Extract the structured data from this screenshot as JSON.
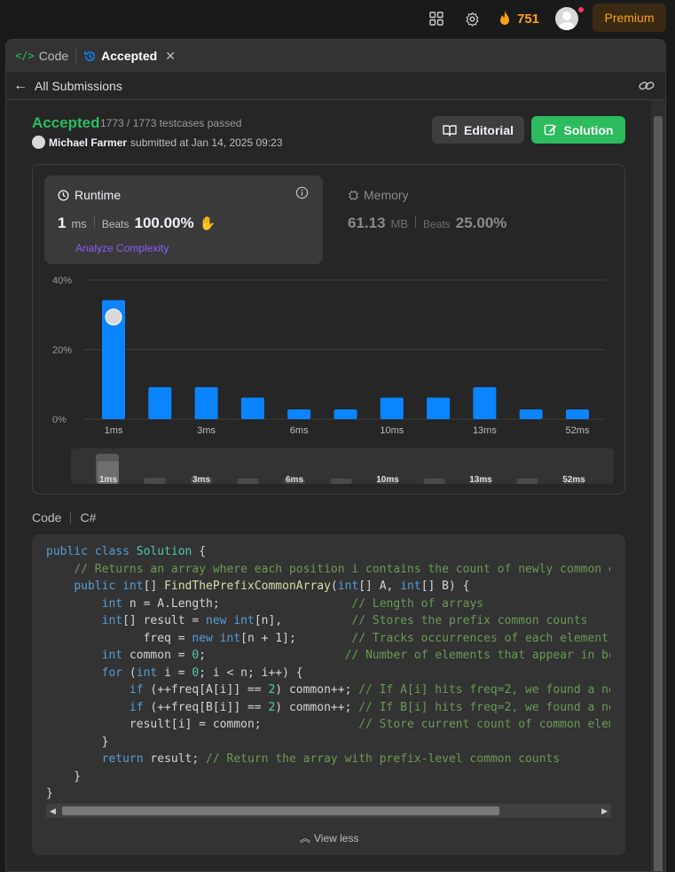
{
  "topbar": {
    "streak_count": "751",
    "premium_label": "Premium"
  },
  "tabs": [
    {
      "label": "Code"
    },
    {
      "label": "Accepted"
    }
  ],
  "subbar": {
    "back_label": "All Submissions"
  },
  "submission": {
    "status": "Accepted",
    "testcases": "1773 / 1773 testcases passed",
    "submitter_name": "Michael Farmer",
    "submitted_text": "submitted at Jan 14, 2025 09:23",
    "editorial_label": "Editorial",
    "solution_label": "Solution"
  },
  "runtime": {
    "title": "Runtime",
    "value": "1",
    "unit": "ms",
    "beats_label": "Beats",
    "beats_value": "100.00%",
    "analyze_label": "Analyze Complexity"
  },
  "memory": {
    "title": "Memory",
    "value": "61.13",
    "unit": "MB",
    "beats_label": "Beats",
    "beats_value": "25.00%"
  },
  "chart_data": {
    "type": "bar",
    "ylim": [
      0,
      40
    ],
    "y_ticks": [
      "40%",
      "20%",
      "0%"
    ],
    "x_labels": [
      "1ms",
      "3ms",
      "6ms",
      "10ms",
      "13ms",
      "52ms"
    ],
    "values": [
      34.2,
      9.2,
      9.2,
      6.2,
      2.8,
      2.8,
      6.2,
      6.2,
      9.2,
      2.8,
      2.8
    ],
    "highlight_index": 0,
    "color": "#0a84ff"
  },
  "code": {
    "section_label": "Code",
    "language": "C#",
    "view_less_label": "View less"
  },
  "colors": {
    "accepted": "#2cbb5d",
    "streak": "#ffa116",
    "analyze": "#8b5cf6"
  }
}
